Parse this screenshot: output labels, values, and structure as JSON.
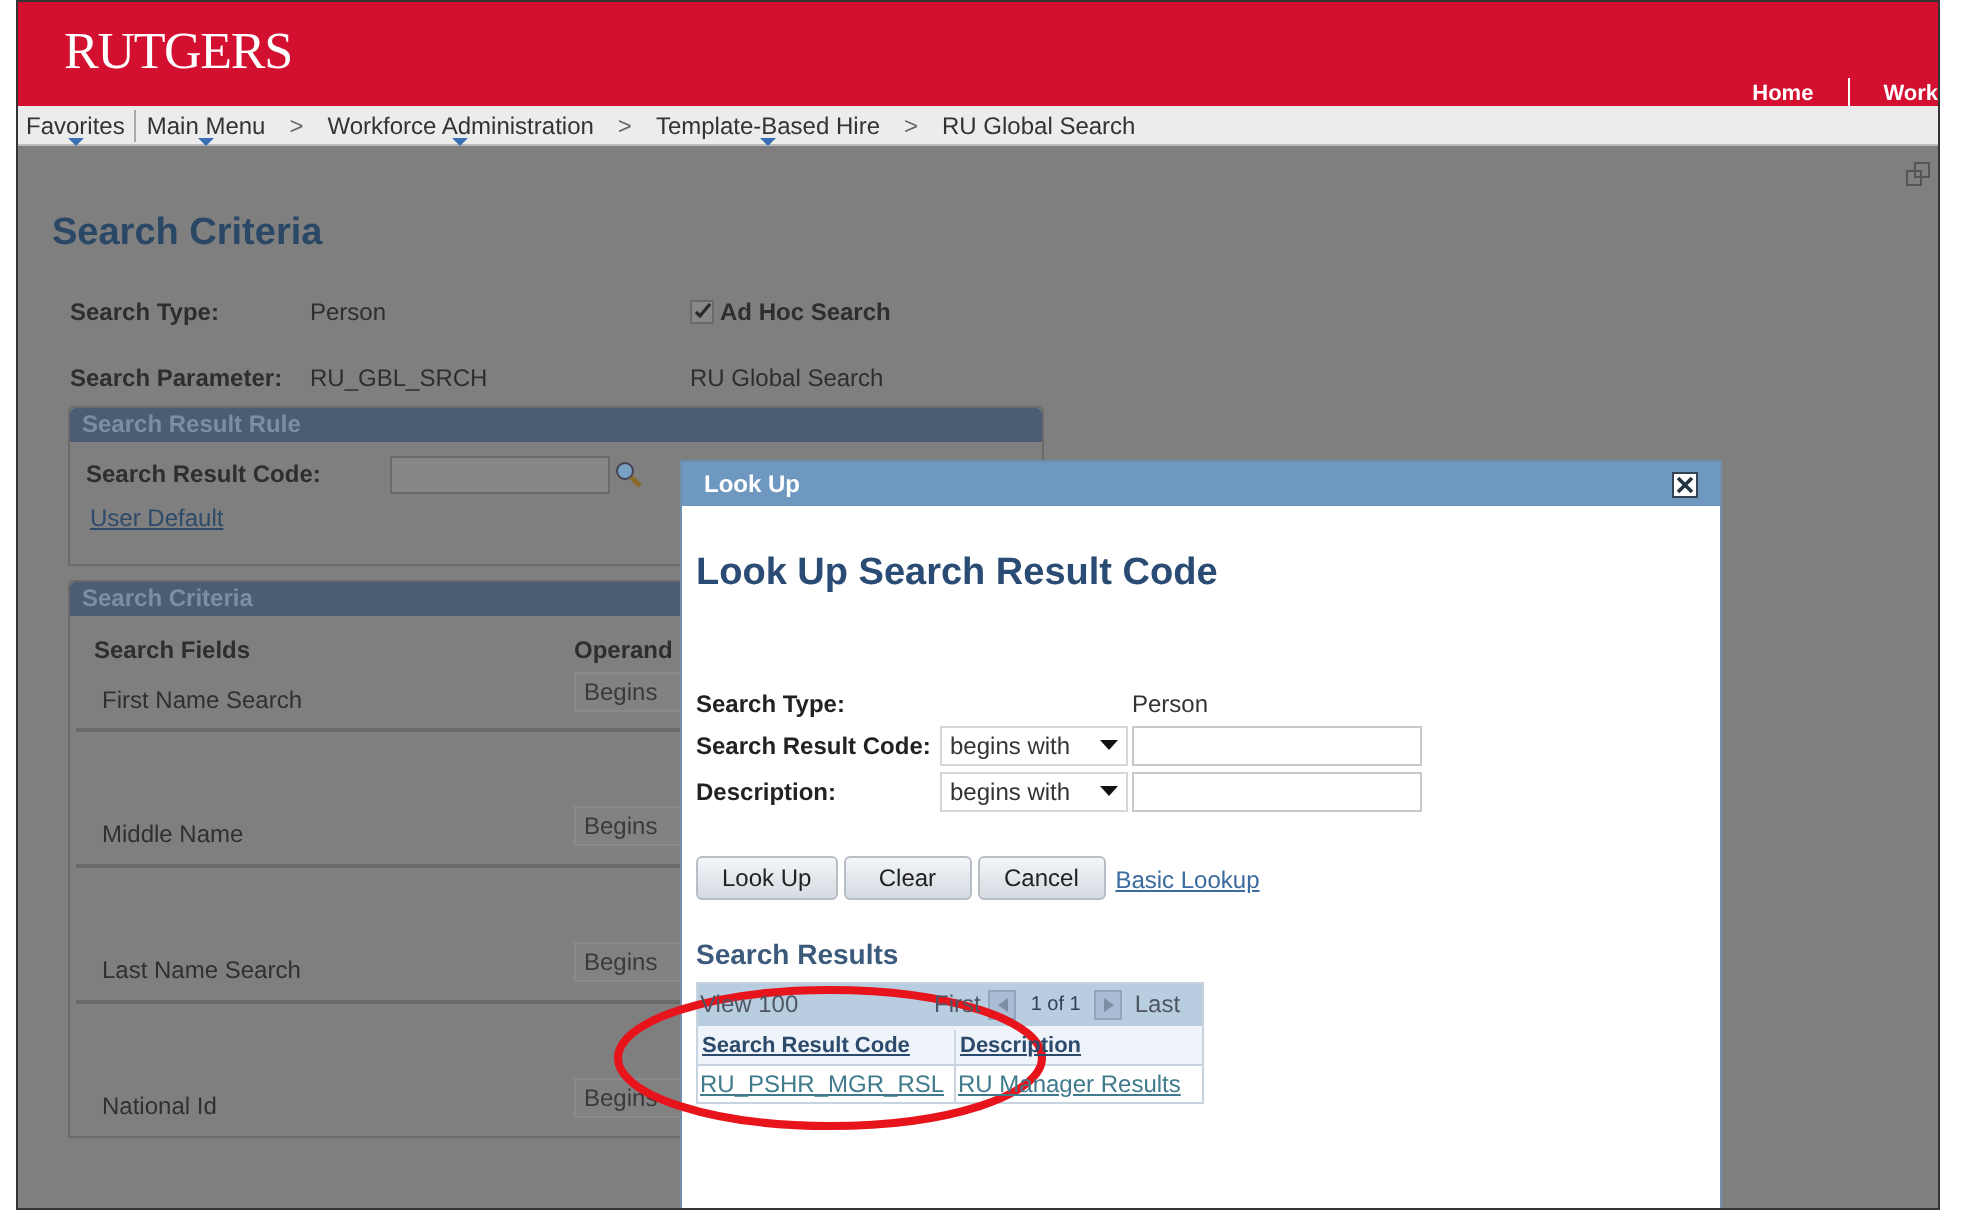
{
  "header": {
    "logo": "RUTGERS",
    "links": [
      "Home",
      "Work"
    ]
  },
  "breadcrumbs": [
    {
      "label": "Favorites",
      "menu": true
    },
    {
      "label": "Main Menu",
      "menu": true
    },
    {
      "label": "Workforce Administration",
      "menu": true,
      "separator": ">"
    },
    {
      "label": "Template-Based Hire",
      "menu": true,
      "separator": ">"
    },
    {
      "label": "RU Global Search",
      "menu": false,
      "separator": ">"
    }
  ],
  "page": {
    "title": "Search Criteria",
    "search_type": {
      "label": "Search Type:",
      "value": "Person"
    },
    "ad_hoc": {
      "label": "Ad Hoc Search",
      "checked": true
    },
    "search_parameter": {
      "label": "Search Parameter:",
      "value": "RU_GBL_SRCH",
      "description": "RU Global Search"
    },
    "result_rule": {
      "title": "Search Result Rule",
      "field_label": "Search Result Code:",
      "link": "User Default"
    },
    "criteria": {
      "title": "Search Criteria",
      "fields_heading": "Search Fields",
      "operand_heading": "Operand",
      "rows": [
        {
          "label": "First Name Search",
          "operand": "Begins"
        },
        {
          "label": "Middle Name",
          "operand": "Begins"
        },
        {
          "label": "Last Name Search",
          "operand": "Begins"
        },
        {
          "label": "National Id",
          "operand": "Begins"
        }
      ]
    }
  },
  "lookup": {
    "title": "Look Up",
    "heading": "Look Up Search Result Code",
    "search_type": {
      "label": "Search Type:",
      "value": "Person"
    },
    "fields": [
      {
        "label": "Search Result Code:",
        "operator": "begins with"
      },
      {
        "label": "Description:",
        "operator": "begins with"
      }
    ],
    "buttons": [
      "Look Up",
      "Clear",
      "Cancel"
    ],
    "link": "Basic Lookup",
    "results": {
      "title": "Search Results",
      "view": "View 100",
      "first": "First",
      "count": "1 of 1",
      "last": "Last",
      "columns": [
        "Search Result Code",
        "Description"
      ],
      "rows": [
        [
          "RU_PSHR_MGR_RSL",
          "RU Manager Results"
        ]
      ]
    }
  }
}
